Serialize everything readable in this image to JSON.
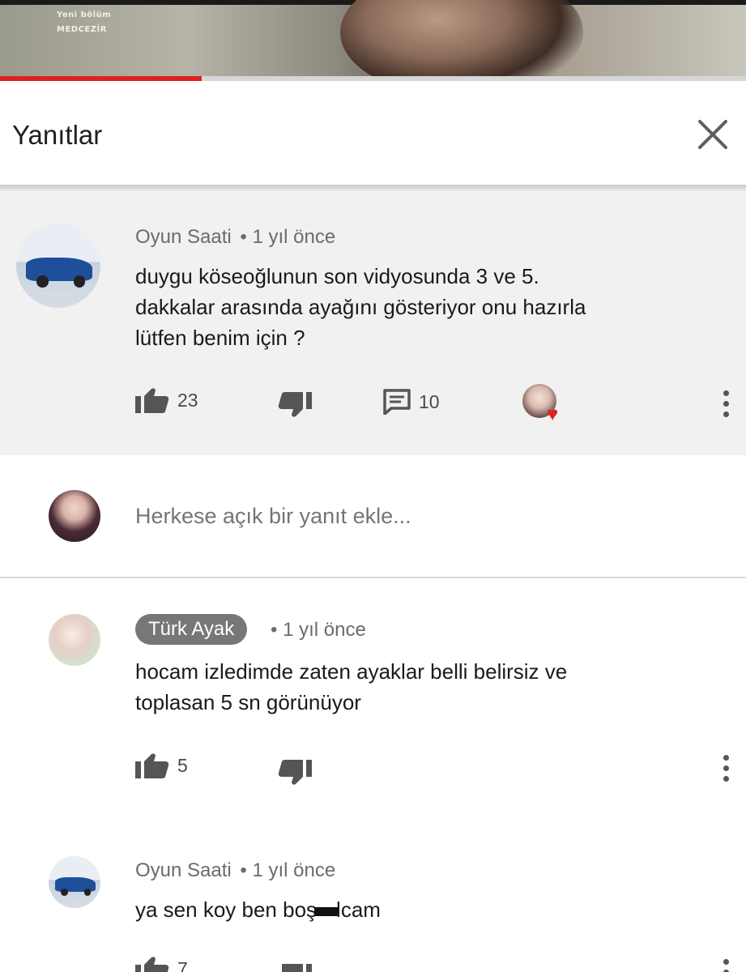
{
  "video": {
    "overlay_line1": "Yeni bölüm",
    "overlay_line2": "MEDCEZİR",
    "progress": 0.27
  },
  "header": {
    "title": "Yanıtlar",
    "close_icon": "close-icon"
  },
  "parent_comment": {
    "author": "Oyun Saati",
    "time": "• 1 yıl önce",
    "text_lines": [
      "duygu köseoğlunun son vidyosunda 3 ve 5.",
      "dakkalar arasında ayağını gösteriyor onu hazırla",
      "lütfen benim için ?"
    ],
    "likes": "23",
    "replies": "10",
    "icons": [
      "thumb-up-icon",
      "thumb-down-icon",
      "reply-icon",
      "creator-heart-icon",
      "more-vert-icon"
    ]
  },
  "reply_input": {
    "placeholder": "Herkese açık bir yanıt ekle..."
  },
  "replies": [
    {
      "author": "Türk Ayak",
      "time": "• 1 yıl önce",
      "text_lines": [
        "hocam izledimde zaten ayaklar belli belirsiz ve",
        "toplasan 5 sn görünüyor"
      ],
      "likes": "5"
    },
    {
      "author": "Oyun Saati",
      "time": "• 1 yıl önce",
      "text_before": "ya sen koy ben boş",
      "text_after": "lcam",
      "likes": "7"
    }
  ],
  "colors": {
    "progress_red": "#e02020",
    "heart_red": "#d92323",
    "parent_background": "#f1f1f1",
    "chip_background": "#777777"
  }
}
